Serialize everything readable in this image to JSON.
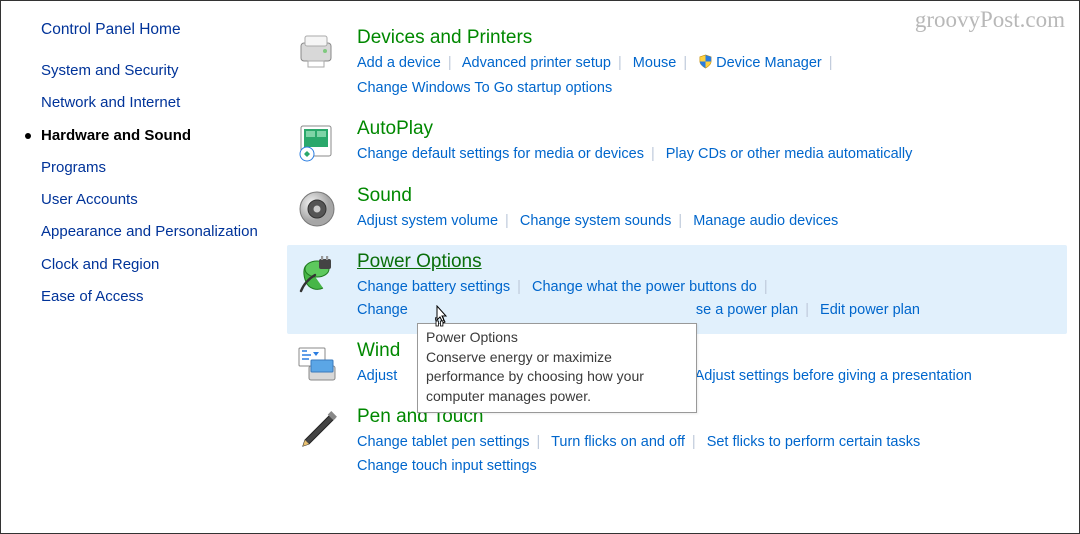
{
  "watermark": "groovyPost.com",
  "sidebar": {
    "home": "Control Panel Home",
    "items": [
      "System and Security",
      "Network and Internet",
      "Hardware and Sound",
      "Programs",
      "User Accounts",
      "Appearance and Personalization",
      "Clock and Region",
      "Ease of Access"
    ],
    "active_index": 2
  },
  "categories": {
    "devices": {
      "title": "Devices and Printers",
      "links": [
        "Add a device",
        "Advanced printer setup",
        "Mouse",
        "Device Manager"
      ],
      "line2": [
        "Change Windows To Go startup options"
      ]
    },
    "autoplay": {
      "title": "AutoPlay",
      "links": [
        "Change default settings for media or devices",
        "Play CDs or other media automatically"
      ]
    },
    "sound": {
      "title": "Sound",
      "links": [
        "Adjust system volume",
        "Change system sounds",
        "Manage audio devices"
      ]
    },
    "power": {
      "title": "Power Options",
      "links": [
        "Change battery settings",
        "Change what the power buttons do"
      ],
      "line2_pre": "Change power button ... Create / choose a power plan",
      "line2": [
        "Change",
        "se a power plan",
        "Edit power plan"
      ]
    },
    "mobility": {
      "title_visible": "Wind",
      "links": [
        "Adjust",
        "Adjust settings before giving a presentation"
      ]
    },
    "pen": {
      "title": "Pen and Touch",
      "links": [
        "Change tablet pen settings",
        "Turn flicks on and off",
        "Set flicks to perform certain tasks"
      ],
      "line2": [
        "Change touch input settings"
      ]
    }
  },
  "tooltip": {
    "title": "Power Options",
    "text": "Conserve energy or maximize performance by choosing how your computer manages power."
  }
}
